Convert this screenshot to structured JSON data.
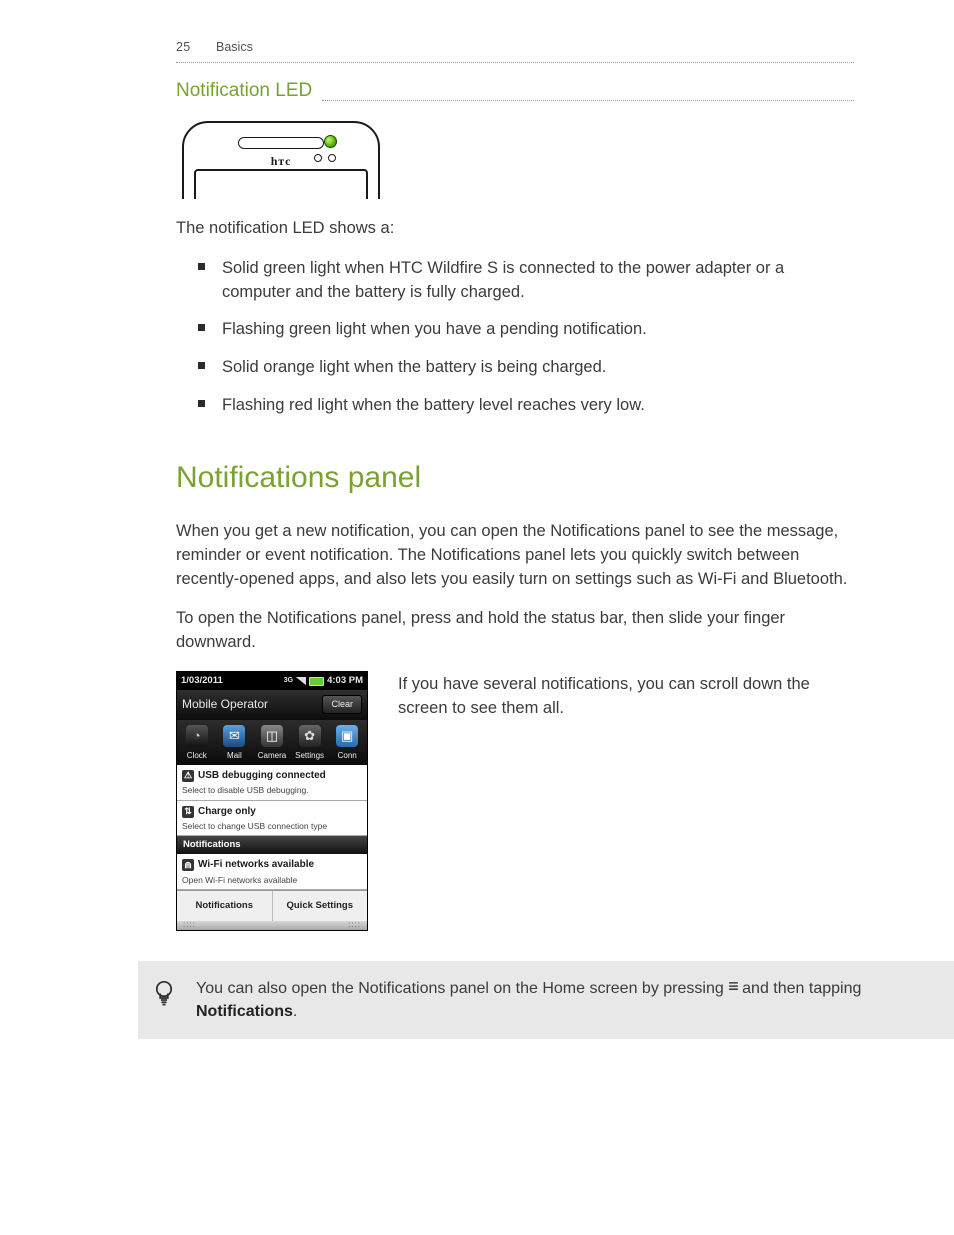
{
  "header": {
    "page_number": "25",
    "section": "Basics"
  },
  "section1": {
    "title": "Notification LED",
    "device_label": "hтс",
    "intro": "The notification LED shows a:",
    "bullets": [
      "Solid green light when HTC Wildfire S is connected to the power adapter or a computer and the battery is fully charged.",
      "Flashing green light when you have a pending notification.",
      "Solid orange light when the battery is being charged.",
      "Flashing red light when the battery level reaches very low."
    ]
  },
  "section2": {
    "title": "Notifications panel",
    "para1": "When you get a new notification, you can open the Notifications panel to see the message, reminder or event notification. The Notifications panel lets you quickly switch between recently-opened apps, and also lets you easily turn on settings such as Wi-Fi and Bluetooth.",
    "para2": "To open the Notifications panel, press and hold the status bar, then slide your finger downward.",
    "side_para": "If you have several notifications, you can scroll down the screen to see them all."
  },
  "screenshot": {
    "date": "1/03/2011",
    "network_mode": "3G",
    "time": "4:03 PM",
    "operator": "Mobile Operator",
    "clear_label": "Clear",
    "apps": [
      {
        "name": "Clock",
        "glyph": "◔"
      },
      {
        "name": "Mail",
        "glyph": "✉"
      },
      {
        "name": "Camera",
        "glyph": "◫"
      },
      {
        "name": "Settings",
        "glyph": "✿"
      },
      {
        "name": "Conn",
        "glyph": "▣"
      }
    ],
    "items": [
      {
        "icon": "⚠",
        "title": "USB debugging connected",
        "sub": "Select to disable USB debugging."
      },
      {
        "icon": "⇅",
        "title": "Charge only",
        "sub": "Select to change USB connection type"
      }
    ],
    "notif_header": "Notifications",
    "wifi": {
      "icon": "⋒",
      "title": "Wi-Fi networks available",
      "sub": "Open Wi-Fi networks available"
    },
    "tabs": [
      "Notifications",
      "Quick Settings"
    ]
  },
  "tip": {
    "pre": "You can also open the Notifications panel on the Home screen by pressing ",
    "post_and": " and then tapping ",
    "word": "Notifications",
    "end": "."
  }
}
